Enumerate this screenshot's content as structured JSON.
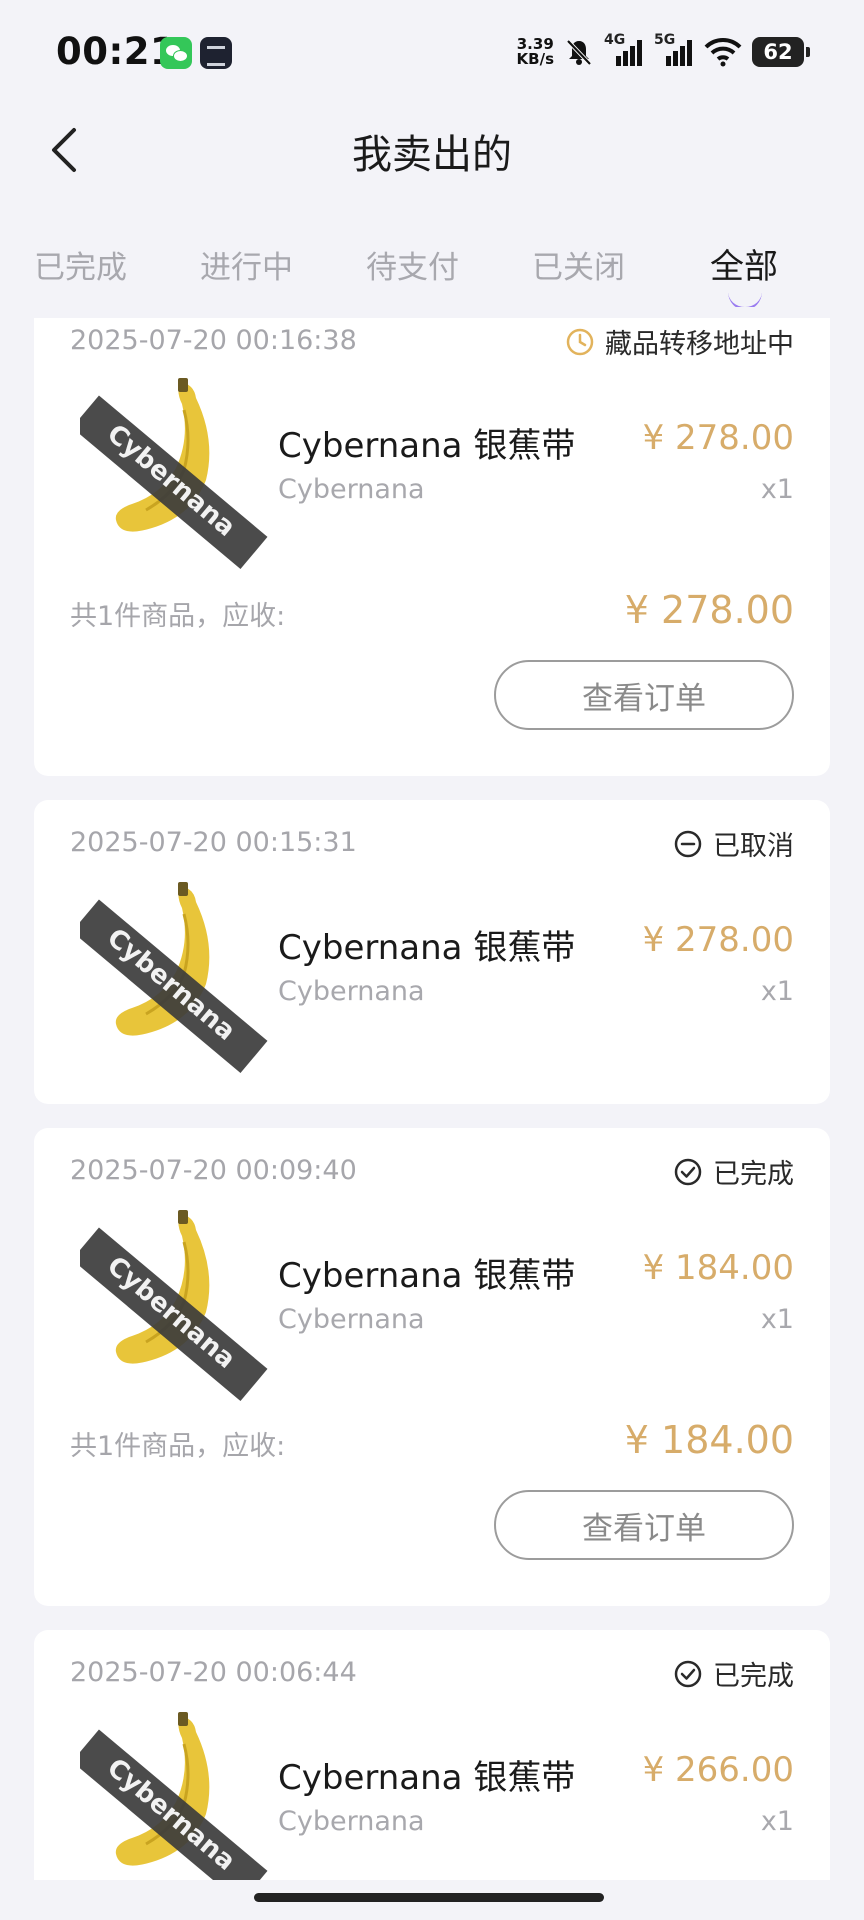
{
  "status_bar": {
    "time": "00:21",
    "net_speed_value": "3.39",
    "net_speed_unit": "KB/s",
    "network_4g": "4G",
    "network_5g": "5G",
    "battery": "62",
    "icons": [
      "wechat-icon",
      "app-icon",
      "bell-muted-icon",
      "signal-4g-icon",
      "signal-5g-icon",
      "wifi-icon",
      "battery-icon"
    ]
  },
  "header": {
    "title": "我卖出的",
    "back_icon": "chevron-left-icon"
  },
  "tabs": [
    {
      "label": "已完成",
      "active": false
    },
    {
      "label": "进行中",
      "active": false
    },
    {
      "label": "待支付",
      "active": false
    },
    {
      "label": "已关闭",
      "active": false
    },
    {
      "label": "全部",
      "active": true
    }
  ],
  "colors": {
    "price": "#D7AC6A",
    "pending_icon": "#E2B35C",
    "tab_indicator": "#9A7CF0",
    "background": "#F3F3F8"
  },
  "orders": [
    {
      "time": "2025-07-20 00:16:38",
      "status": "藏品转移地址中",
      "status_icon": "clock-icon",
      "item_name": "Cybernana 银蕉带",
      "brand": "Cybernana",
      "price": "¥ 278.00",
      "qty": "x1",
      "total_label": "共1件商品，应收:",
      "total": "¥ 278.00",
      "button": "查看订单"
    },
    {
      "time": "2025-07-20 00:15:31",
      "status": "已取消",
      "status_icon": "minus-circle-icon",
      "item_name": "Cybernana 银蕉带",
      "brand": "Cybernana",
      "price": "¥ 278.00",
      "qty": "x1"
    },
    {
      "time": "2025-07-20 00:09:40",
      "status": "已完成",
      "status_icon": "check-circle-icon",
      "item_name": "Cybernana 银蕉带",
      "brand": "Cybernana",
      "price": "¥ 184.00",
      "qty": "x1",
      "total_label": "共1件商品，应收:",
      "total": "¥ 184.00",
      "button": "查看订单"
    },
    {
      "time": "2025-07-20 00:06:44",
      "status": "已完成",
      "status_icon": "check-circle-icon",
      "item_name": "Cybernana 银蕉带",
      "brand": "Cybernana",
      "price": "¥ 266.00",
      "qty": "x1"
    }
  ]
}
